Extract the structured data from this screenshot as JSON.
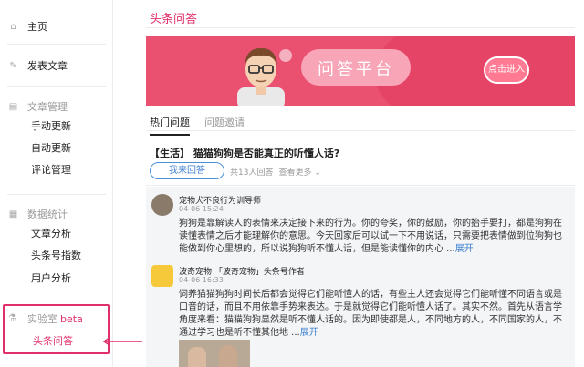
{
  "sidebar": {
    "home": "主页",
    "publish": "发表文章",
    "article_mgmt": {
      "label": "文章管理",
      "items": [
        "手动更新",
        "自动更新",
        "评论管理"
      ]
    },
    "stats": {
      "label": "数据统计",
      "items": [
        "文章分析",
        "头条号指数",
        "用户分析"
      ]
    },
    "lab": {
      "label": "实验室",
      "badge": "beta",
      "items": [
        "头条问答"
      ]
    }
  },
  "main": {
    "page_title": "头条问答",
    "banner": {
      "title": "问答平台",
      "cta": "点击进入"
    },
    "tabs": [
      "热门问题",
      "问题邀请"
    ],
    "question": {
      "title": "【生活】 猫猫狗狗是否能真正的听懂人话?",
      "answer_button": "我来回答",
      "answer_count": "共13人回答",
      "view_more": "查看更多 ⌄"
    },
    "answers": [
      {
        "author": "宠物犬不良行为训导师",
        "time": "04-06 15:24",
        "body": "狗狗是靠解读人的表情来决定接下来的行为。你的夸奖，你的鼓励，你的抬手要打，都是狗狗在读懂表情之后才能理解你的意思。今天回家后可以试一下不用说话，只需要把表情做到位狗狗也能做到你心里想的，所以说狗狗听不懂人话，但是能读懂你的内心 ...",
        "expand": "展开"
      },
      {
        "author": "波奇宠物 「波奇宠物」头条号作者",
        "time": "04-06 16:33",
        "body": "饲养猫猫狗狗时间长后都会觉得它们能听懂人的话，有些主人还会觉得它们能听懂不同语言或是口音的话，而且不用依靠手势来表达。于是就觉得它们能听懂人话了。其实不然。首先从语言学角度来看：猫猫狗狗显然是听不懂人话的。因为即使都是人，不同地方的人，不同国家的人，不通过学习也是听不懂其他地 ...",
        "expand": "展开"
      }
    ]
  },
  "colors": {
    "accent": "#e0306a",
    "banner": "#ea5070",
    "link": "#3a7fd0"
  },
  "icons": [
    "home-icon",
    "edit-icon",
    "document-icon",
    "chart-icon",
    "flask-icon",
    "chevron-down-icon"
  ]
}
